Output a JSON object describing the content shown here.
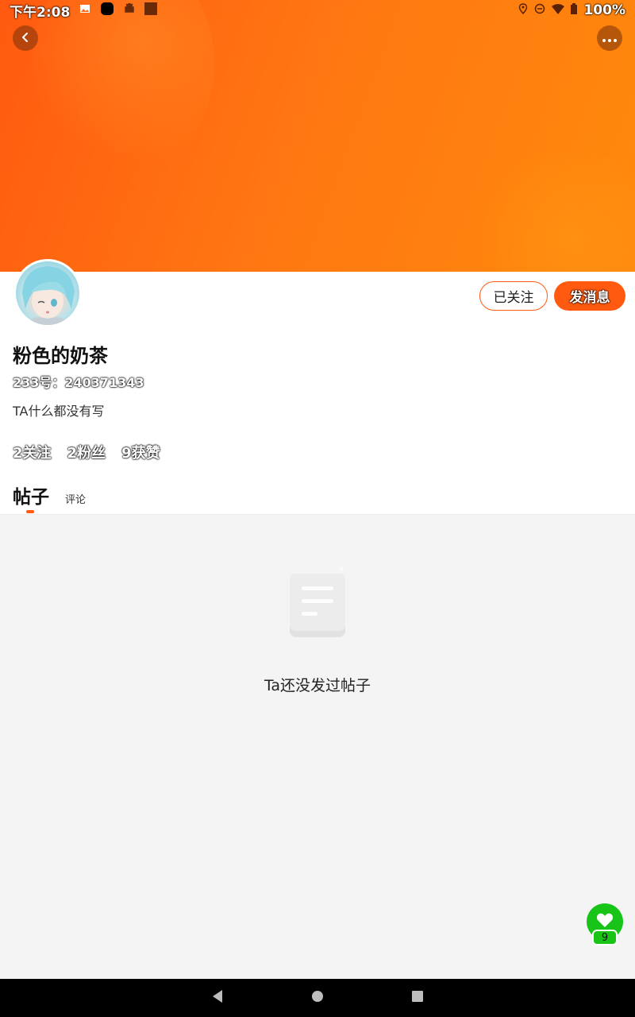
{
  "status_bar": {
    "time": "下午2:08",
    "battery": "100%",
    "icons": [
      "image-icon",
      "app-icon",
      "android-icon",
      "square-icon",
      "location-icon",
      "dnd-icon",
      "wifi-icon",
      "battery-icon"
    ]
  },
  "header": {
    "back_icon": "chevron-left-icon",
    "more_icon": "more-dots-icon"
  },
  "profile": {
    "name": "粉色的奶茶",
    "uid_label": "233号：240371343",
    "bio": "TA什么都没有写",
    "follow_button": "已关注",
    "message_button": "发消息",
    "stats": {
      "following": "2关注",
      "fans": "2粉丝",
      "likes": "9获赞"
    }
  },
  "tabs": [
    {
      "label": "帖子",
      "active": true
    },
    {
      "label": "评论",
      "active": false
    }
  ],
  "empty_state": {
    "icon": "document-icon",
    "text": "Ta还没发过帖子"
  },
  "like_fab": {
    "icon": "heart-icon",
    "count": "9"
  },
  "colors": {
    "accent": "#ff5a10",
    "like_green": "#19c419",
    "banner_start": "#ff5a10",
    "banner_end": "#ff8a0c"
  }
}
